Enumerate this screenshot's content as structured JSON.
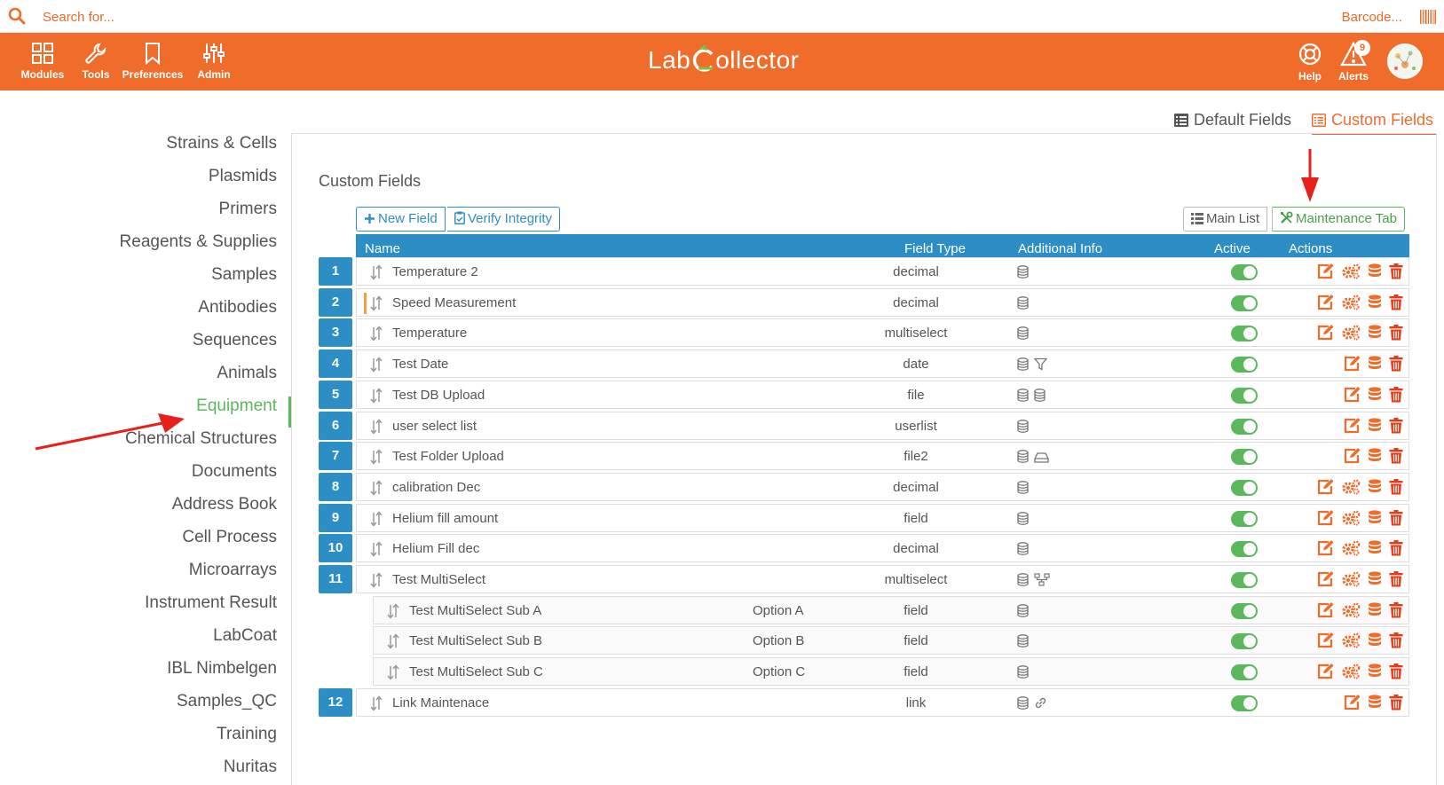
{
  "search": {
    "placeholder": "Search for...",
    "barcode_placeholder": "Barcode..."
  },
  "nav": {
    "items": [
      {
        "label": "Modules"
      },
      {
        "label": "Tools"
      },
      {
        "label": "Preferences"
      },
      {
        "label": "Admin"
      }
    ],
    "right": [
      {
        "label": "Help"
      },
      {
        "label": "Alerts"
      }
    ],
    "alert_count": "9",
    "logo_left": "Lab",
    "logo_right": "ollector"
  },
  "field_tabs": {
    "default": "Default Fields",
    "custom": "Custom Fields"
  },
  "sidebar": {
    "items": [
      "Strains & Cells",
      "Plasmids",
      "Primers",
      "Reagents & Supplies",
      "Samples",
      "Antibodies",
      "Sequences",
      "Animals",
      "Equipment",
      "Chemical Structures",
      "Documents",
      "Address Book",
      "Cell Process",
      "Microarrays",
      "Instrument Result",
      "LabCoat",
      "IBL Nimbelgen",
      "Samples_QC",
      "Training",
      "Nuritas"
    ],
    "active": "Equipment"
  },
  "panel": {
    "title": "Custom Fields",
    "new_field": "New Field",
    "verify": "Verify Integrity",
    "main_list": "Main List",
    "maintenance_tab": "Maintenance Tab"
  },
  "table": {
    "headers": {
      "name": "Name",
      "type": "Field Type",
      "info": "Additional Info",
      "active": "Active",
      "actions": "Actions"
    },
    "rows": [
      {
        "num": "1",
        "name": "Temperature 2",
        "option": "",
        "type": "decimal",
        "info": [
          "db"
        ],
        "actions": [
          "edit",
          "gear",
          "db",
          "trash"
        ],
        "sub": false
      },
      {
        "num": "2",
        "name": "Speed Measurement",
        "option": "",
        "type": "decimal",
        "info": [
          "db"
        ],
        "actions": [
          "edit",
          "gear",
          "db",
          "trash"
        ],
        "sub": false
      },
      {
        "num": "3",
        "name": "Temperature",
        "option": "",
        "type": "multiselect",
        "info": [
          "db"
        ],
        "actions": [
          "edit",
          "gear",
          "db",
          "trash"
        ],
        "sub": false
      },
      {
        "num": "4",
        "name": "Test Date",
        "option": "",
        "type": "date",
        "info": [
          "db",
          "filter"
        ],
        "actions": [
          "edit",
          "db",
          "trash"
        ],
        "sub": false
      },
      {
        "num": "5",
        "name": "Test DB Upload",
        "option": "",
        "type": "file",
        "info": [
          "db",
          "db"
        ],
        "actions": [
          "edit",
          "db",
          "trash"
        ],
        "sub": false
      },
      {
        "num": "6",
        "name": "user select list",
        "option": "",
        "type": "userlist",
        "info": [
          "db"
        ],
        "actions": [
          "edit",
          "db",
          "trash"
        ],
        "sub": false
      },
      {
        "num": "7",
        "name": "Test Folder Upload",
        "option": "",
        "type": "file2",
        "info": [
          "db",
          "drive"
        ],
        "actions": [
          "edit",
          "db",
          "trash"
        ],
        "sub": false
      },
      {
        "num": "8",
        "name": "calibration Dec",
        "option": "",
        "type": "decimal",
        "info": [
          "db"
        ],
        "actions": [
          "edit",
          "gear",
          "db",
          "trash"
        ],
        "sub": false
      },
      {
        "num": "9",
        "name": "Helium fill amount",
        "option": "",
        "type": "field",
        "info": [
          "db"
        ],
        "actions": [
          "edit",
          "gear",
          "db",
          "trash"
        ],
        "sub": false
      },
      {
        "num": "10",
        "name": "Helium Fill dec",
        "option": "",
        "type": "decimal",
        "info": [
          "db"
        ],
        "actions": [
          "edit",
          "gear",
          "db",
          "trash"
        ],
        "sub": false
      },
      {
        "num": "11",
        "name": "Test MultiSelect",
        "option": "",
        "type": "multiselect",
        "info": [
          "db",
          "tree"
        ],
        "actions": [
          "edit",
          "gear",
          "db",
          "trash"
        ],
        "sub": false
      },
      {
        "num": "",
        "name": "Test MultiSelect Sub A",
        "option": "Option A",
        "type": "field",
        "info": [
          "db"
        ],
        "actions": [
          "edit",
          "gear",
          "db",
          "trash"
        ],
        "sub": true
      },
      {
        "num": "",
        "name": "Test MultiSelect Sub B",
        "option": "Option B",
        "type": "field",
        "info": [
          "db"
        ],
        "actions": [
          "edit",
          "gear",
          "db",
          "trash"
        ],
        "sub": true
      },
      {
        "num": "",
        "name": "Test MultiSelect Sub C",
        "option": "Option C",
        "type": "field",
        "info": [
          "db"
        ],
        "actions": [
          "edit",
          "gear",
          "db",
          "trash"
        ],
        "sub": true
      },
      {
        "num": "12",
        "name": "Link Maintenace",
        "option": "",
        "type": "link",
        "info": [
          "db",
          "link"
        ],
        "actions": [
          "edit",
          "db",
          "trash"
        ],
        "sub": false
      }
    ]
  },
  "colors": {
    "orange": "#f06c2b",
    "blue": "#2d8ec5",
    "green": "#5cb85c",
    "red": "#e23c1a"
  }
}
